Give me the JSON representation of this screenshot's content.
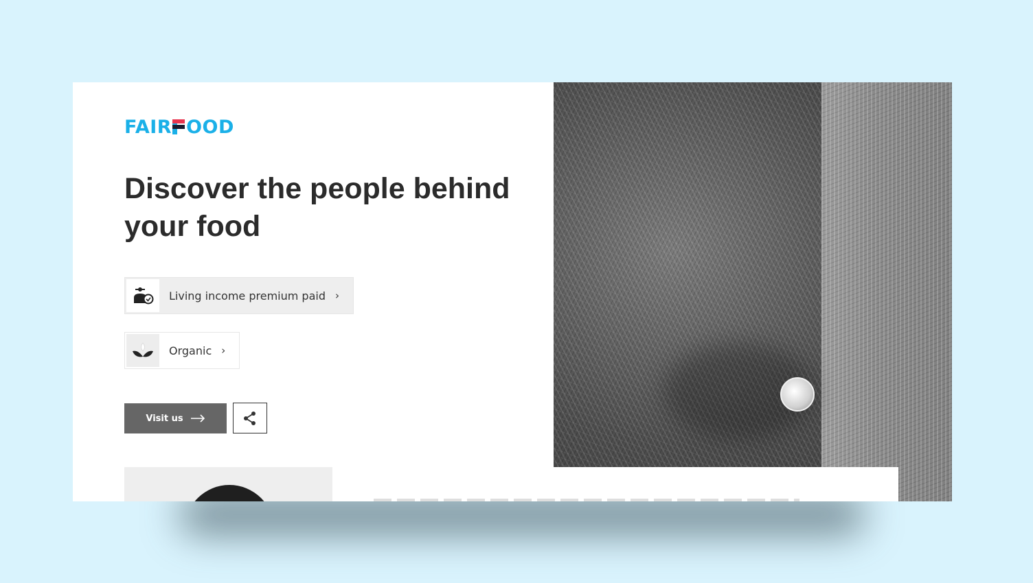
{
  "brand": {
    "name_part1": "FAIR",
    "name_part2": "OOD",
    "colors": {
      "blue": "#1ab0e8",
      "red": "#e8344e",
      "navy": "#1a1a2e"
    }
  },
  "hero": {
    "title": "Discover the people behind your food"
  },
  "claims": [
    {
      "label": "Living income premium paid",
      "icon": "farmer-coin-icon",
      "chevron": "›"
    },
    {
      "label": "Organic",
      "icon": "leaf-sprout-icon",
      "chevron": "›"
    }
  ],
  "actions": {
    "visit_label": "Visit us",
    "visit_icon": "arrow-right-icon",
    "share_icon": "share-icon"
  },
  "colors": {
    "page_bg": "#d9f3fd",
    "card_bg": "#ffffff",
    "text": "#2b2b2b",
    "button_bg": "#666666"
  }
}
